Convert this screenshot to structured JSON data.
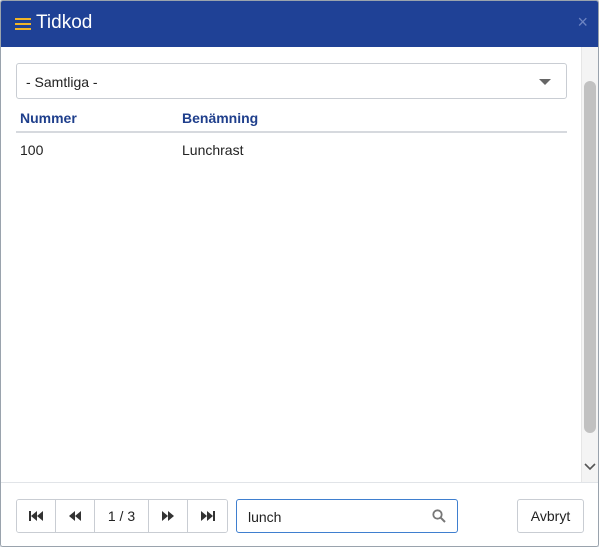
{
  "dialog": {
    "title": "Tidkod",
    "close_label": "×"
  },
  "filter": {
    "selected": "- Samtliga -"
  },
  "table": {
    "headers": [
      "Nummer",
      "Benämning"
    ],
    "rows": [
      {
        "nummer": "100",
        "benamning": "Lunchrast"
      }
    ]
  },
  "pager": {
    "page_info": "1 / 3"
  },
  "search": {
    "value": "lunch"
  },
  "buttons": {
    "cancel": "Avbryt"
  },
  "colors": {
    "titlebar": "#1f4196",
    "hamburger": "#f0b429",
    "header_text": "#1f3f8c",
    "search_border": "#3f7fcf"
  },
  "icons": {
    "menu": "hamburger-icon",
    "close": "close-icon",
    "first": "first-page-icon",
    "prev": "previous-page-icon",
    "next": "next-page-icon",
    "last": "last-page-icon",
    "search": "search-icon",
    "dropdown": "chevron-down-icon"
  }
}
